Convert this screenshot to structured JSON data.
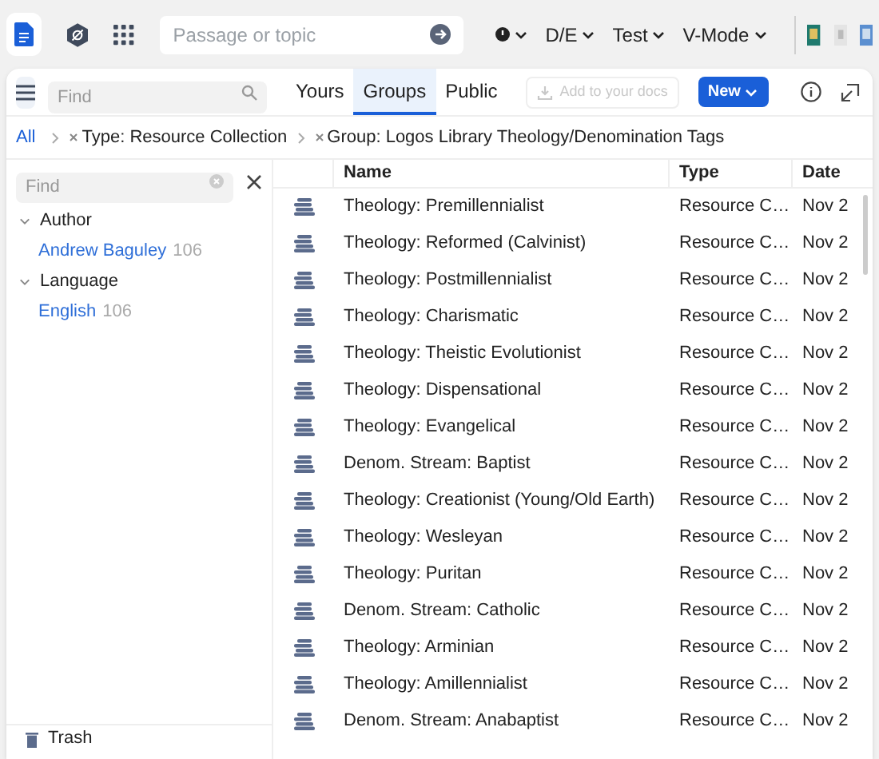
{
  "toolbar": {
    "search": {
      "placeholder": "Passage or topic"
    },
    "menus": [
      {
        "kind": "icon"
      },
      {
        "kind": "text",
        "label": "D/E"
      },
      {
        "kind": "text",
        "label": "Test"
      },
      {
        "kind": "text",
        "label": "V-Mode"
      }
    ]
  },
  "panel": {
    "find": {
      "placeholder": "Find"
    },
    "tabs": [
      {
        "label": "Yours",
        "selected": false
      },
      {
        "label": "Groups",
        "selected": true
      },
      {
        "label": "Public",
        "selected": false
      }
    ],
    "add_button": {
      "label": "Add to your docs",
      "disabled": true
    },
    "new_button": {
      "label": "New"
    },
    "breadcrumbs": [
      {
        "label": "All",
        "kind": "link"
      },
      {
        "label": "Type: Resource Collection",
        "kind": "filter"
      },
      {
        "label": "Group: Logos Library Theology/Denomination Tags",
        "kind": "filter"
      }
    ],
    "facet_find": {
      "placeholder": "Find"
    },
    "facets": [
      {
        "label": "Author",
        "expanded": true,
        "children": [
          {
            "label": "Andrew Baguley",
            "count": "106"
          }
        ]
      },
      {
        "label": "Language",
        "expanded": true,
        "children": [
          {
            "label": "English",
            "count": "106"
          }
        ]
      }
    ],
    "trash": "Trash",
    "table": {
      "columns": [
        "Name",
        "Type",
        "Date"
      ],
      "rows": [
        [
          "Theology: Premillennialist",
          "Resource C…",
          "Nov 2"
        ],
        [
          "Theology: Reformed (Calvinist)",
          "Resource C…",
          "Nov 2"
        ],
        [
          "Theology: Postmillennialist",
          "Resource C…",
          "Nov 2"
        ],
        [
          "Theology: Charismatic",
          "Resource C…",
          "Nov 2"
        ],
        [
          "Theology: Theistic Evolutionist",
          "Resource C…",
          "Nov 2"
        ],
        [
          "Theology: Dispensational",
          "Resource C…",
          "Nov 2"
        ],
        [
          "Theology: Evangelical",
          "Resource C…",
          "Nov 2"
        ],
        [
          "Denom. Stream: Baptist",
          "Resource C…",
          "Nov 2"
        ],
        [
          "Theology: Creationist (Young/Old Earth)",
          "Resource C…",
          "Nov 2"
        ],
        [
          "Theology: Wesleyan",
          "Resource C…",
          "Nov 2"
        ],
        [
          "Theology: Puritan",
          "Resource C…",
          "Nov 2"
        ],
        [
          "Denom. Stream: Catholic",
          "Resource C…",
          "Nov 2"
        ],
        [
          "Theology: Arminian",
          "Resource C…",
          "Nov 2"
        ],
        [
          "Theology: Amillennialist",
          "Resource C…",
          "Nov 2"
        ],
        [
          "Denom. Stream: Anabaptist",
          "Resource C…",
          "Nov 2"
        ]
      ]
    }
  }
}
